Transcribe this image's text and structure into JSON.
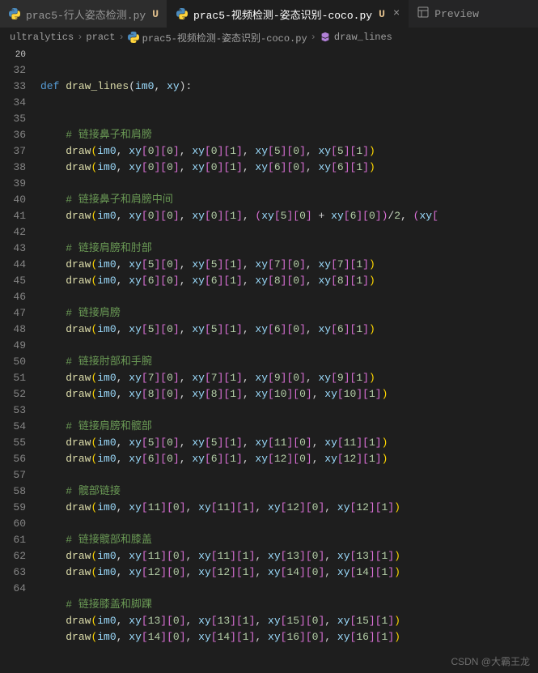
{
  "tabs": [
    {
      "label": "prac5-行人姿态检测.py",
      "modified": "U"
    },
    {
      "label": "prac5-视频检测-姿态识别-coco.py",
      "modified": "U"
    }
  ],
  "preview_label": "Preview",
  "breadcrumbs": {
    "parts": [
      "ultralytics",
      "pract",
      "prac5-视频检测-姿态识别-coco.py",
      "draw_lines"
    ],
    "sep": "›"
  },
  "def_lineno": "20",
  "def_kw": "def",
  "def_name": "draw_lines",
  "def_params": "(im0, xy):",
  "lines": [
    {
      "n": "32",
      "type": "comment_partial",
      "text": "# 链接鼻子和肩膀"
    },
    {
      "n": "33",
      "type": "draw4",
      "a": "0",
      "b": "0",
      "c": "0",
      "d": "1",
      "e": "5",
      "f": "0",
      "g": "5",
      "h": "1"
    },
    {
      "n": "34",
      "type": "draw4",
      "a": "0",
      "b": "0",
      "c": "0",
      "d": "1",
      "e": "6",
      "f": "0",
      "g": "6",
      "h": "1"
    },
    {
      "n": "35",
      "type": "blank"
    },
    {
      "n": "36",
      "type": "comment",
      "text": "# 链接鼻子和肩膀中间"
    },
    {
      "n": "37",
      "type": "draw_mid"
    },
    {
      "n": "38",
      "type": "blank"
    },
    {
      "n": "39",
      "type": "comment",
      "text": "# 链接肩膀和肘部"
    },
    {
      "n": "40",
      "type": "draw4",
      "a": "5",
      "b": "0",
      "c": "5",
      "d": "1",
      "e": "7",
      "f": "0",
      "g": "7",
      "h": "1"
    },
    {
      "n": "41",
      "type": "draw4",
      "a": "6",
      "b": "0",
      "c": "6",
      "d": "1",
      "e": "8",
      "f": "0",
      "g": "8",
      "h": "1"
    },
    {
      "n": "42",
      "type": "blank"
    },
    {
      "n": "43",
      "type": "comment",
      "text": "# 链接肩膀"
    },
    {
      "n": "44",
      "type": "draw4",
      "a": "5",
      "b": "0",
      "c": "5",
      "d": "1",
      "e": "6",
      "f": "0",
      "g": "6",
      "h": "1"
    },
    {
      "n": "45",
      "type": "blank"
    },
    {
      "n": "46",
      "type": "comment",
      "text": "# 链接肘部和手腕"
    },
    {
      "n": "47",
      "type": "draw4",
      "a": "7",
      "b": "0",
      "c": "7",
      "d": "1",
      "e": "9",
      "f": "0",
      "g": "9",
      "h": "1"
    },
    {
      "n": "48",
      "type": "draw4",
      "a": "8",
      "b": "0",
      "c": "8",
      "d": "1",
      "e": "10",
      "f": "0",
      "g": "10",
      "h": "1"
    },
    {
      "n": "49",
      "type": "blank"
    },
    {
      "n": "50",
      "type": "comment",
      "text": "# 链接肩膀和髋部"
    },
    {
      "n": "51",
      "type": "draw4",
      "a": "5",
      "b": "0",
      "c": "5",
      "d": "1",
      "e": "11",
      "f": "0",
      "g": "11",
      "h": "1"
    },
    {
      "n": "52",
      "type": "draw4",
      "a": "6",
      "b": "0",
      "c": "6",
      "d": "1",
      "e": "12",
      "f": "0",
      "g": "12",
      "h": "1"
    },
    {
      "n": "53",
      "type": "blank"
    },
    {
      "n": "54",
      "type": "comment",
      "text": "# 髋部链接"
    },
    {
      "n": "55",
      "type": "draw4",
      "a": "11",
      "b": "0",
      "c": "11",
      "d": "1",
      "e": "12",
      "f": "0",
      "g": "12",
      "h": "1"
    },
    {
      "n": "56",
      "type": "blank"
    },
    {
      "n": "57",
      "type": "comment",
      "text": "# 链接髋部和膝盖"
    },
    {
      "n": "58",
      "type": "draw4",
      "a": "11",
      "b": "0",
      "c": "11",
      "d": "1",
      "e": "13",
      "f": "0",
      "g": "13",
      "h": "1"
    },
    {
      "n": "59",
      "type": "draw4",
      "a": "12",
      "b": "0",
      "c": "12",
      "d": "1",
      "e": "14",
      "f": "0",
      "g": "14",
      "h": "1"
    },
    {
      "n": "60",
      "type": "blank"
    },
    {
      "n": "61",
      "type": "comment",
      "text": "# 链接膝盖和脚踝"
    },
    {
      "n": "62",
      "type": "draw4",
      "a": "13",
      "b": "0",
      "c": "13",
      "d": "1",
      "e": "15",
      "f": "0",
      "g": "15",
      "h": "1"
    },
    {
      "n": "63",
      "type": "draw4",
      "a": "14",
      "b": "0",
      "c": "14",
      "d": "1",
      "e": "16",
      "f": "0",
      "g": "16",
      "h": "1"
    },
    {
      "n": "64",
      "type": "blank"
    }
  ],
  "watermark": "CSDN @大霸王龙"
}
